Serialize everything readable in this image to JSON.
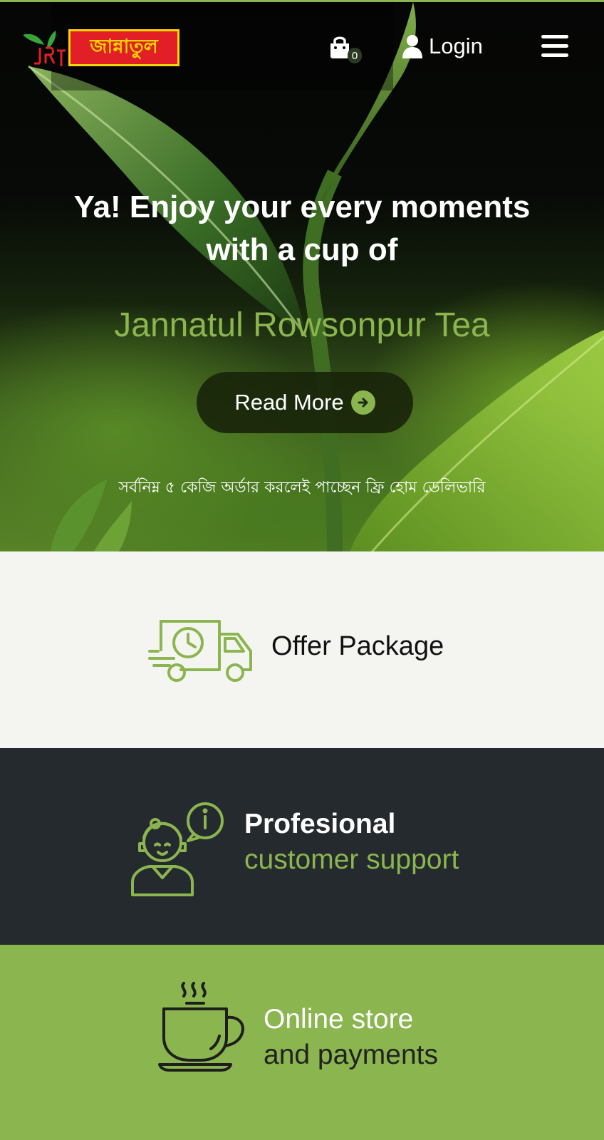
{
  "header": {
    "logo_text": "জান্নাতুল",
    "logo_initials": "JRT",
    "cart_count": "0",
    "login_label": "Login"
  },
  "hero": {
    "title": "Ya! Enjoy your every moments with a cup of",
    "brand": "Jannatul Rowsonpur Tea",
    "read_more_label": "Read More",
    "delivery_note": "সর্বনিম্ন ৫ কেজি অর্ডার করলেই পাচ্ছেন ফ্রি হোম ডেলিভারি"
  },
  "features": {
    "offer": {
      "label": "Offer Package",
      "icon": "delivery-truck-icon"
    },
    "support": {
      "line1": "Profesional",
      "line2": "customer support",
      "icon": "customer-support-icon"
    },
    "store": {
      "line1": "Online store",
      "line2": "and payments",
      "icon": "coffee-cup-icon"
    }
  },
  "colors": {
    "accent": "#8bb54f",
    "logo_red": "#e21f26",
    "logo_yellow": "#f5d400",
    "dark_section": "#242a2e",
    "light_section": "#f4f5f1"
  }
}
